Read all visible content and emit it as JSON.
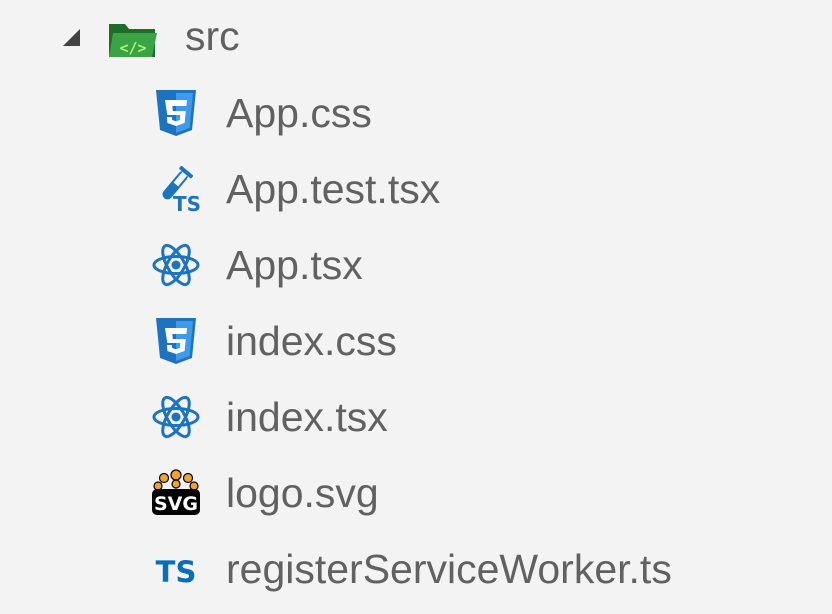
{
  "explorer": {
    "folder": {
      "name": "src",
      "expanded": true,
      "icon": "folder-src-open-icon",
      "color": "#2e8b3d"
    },
    "files": [
      {
        "name": "App.css",
        "icon": "css3-icon"
      },
      {
        "name": "App.test.tsx",
        "icon": "ts-test-icon"
      },
      {
        "name": "App.tsx",
        "icon": "react-icon"
      },
      {
        "name": "index.css",
        "icon": "css3-icon"
      },
      {
        "name": "index.tsx",
        "icon": "react-icon"
      },
      {
        "name": "logo.svg",
        "icon": "svg-icon"
      },
      {
        "name": "registerServiceWorker.ts",
        "icon": "typescript-icon"
      }
    ],
    "colors": {
      "background": "#f3f3f3",
      "label": "#616161",
      "css": "#1e73be",
      "react": "#1e73be",
      "typescript": "#0a6db8",
      "folder": "#2e8b3d"
    }
  }
}
